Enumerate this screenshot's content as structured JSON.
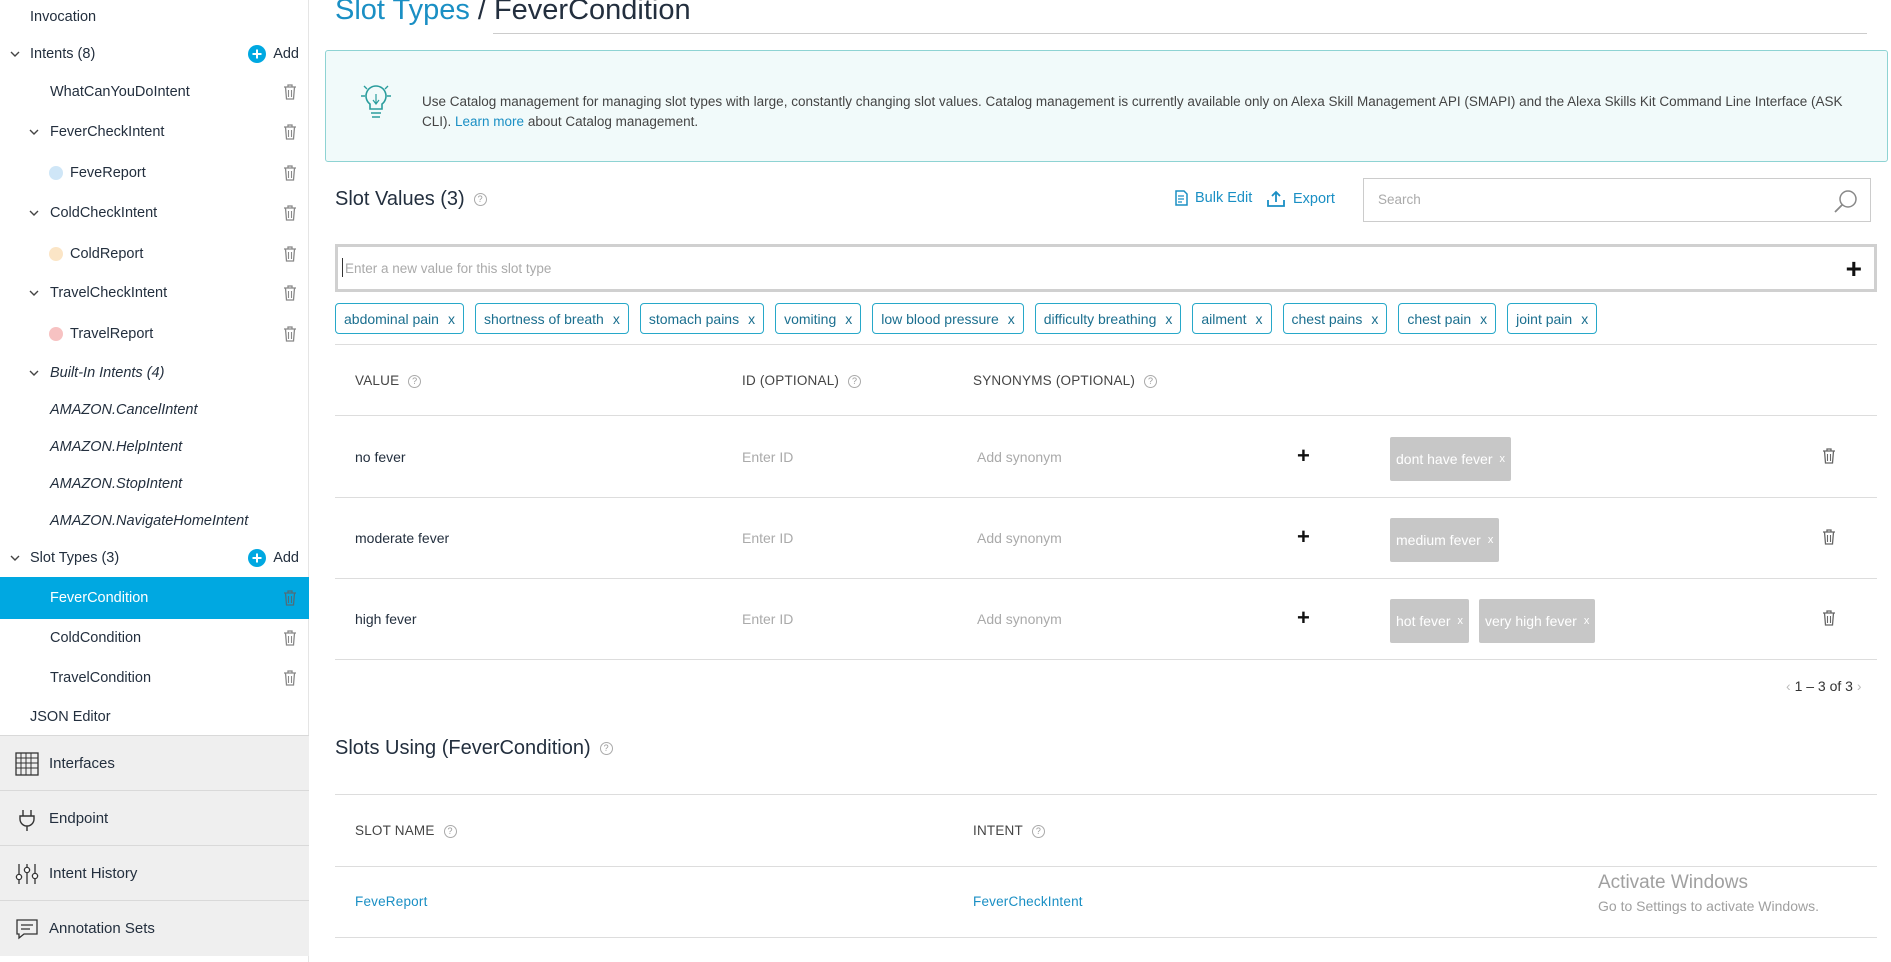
{
  "sidebar": {
    "invocation": "Invocation",
    "intents_header": "Intents (8)",
    "add_label": "Add",
    "intents": [
      {
        "label": "WhatCanYouDoIntent"
      },
      {
        "label": "FeverCheckIntent",
        "slot": "FeveReport",
        "slot_color": "#cfe6f7"
      },
      {
        "label": "ColdCheckIntent",
        "slot": "ColdReport",
        "slot_color": "#fbe5c6"
      },
      {
        "label": "TravelCheckIntent",
        "slot": "TravelReport",
        "slot_color": "#f7c2c2"
      }
    ],
    "builtin_header": "Built-In Intents (4)",
    "builtin": [
      "AMAZON.CancelIntent",
      "AMAZON.HelpIntent",
      "AMAZON.StopIntent",
      "AMAZON.NavigateHomeIntent"
    ],
    "slot_types_header": "Slot Types (3)",
    "slot_types": [
      "FeverCondition",
      "ColdCondition",
      "TravelCondition"
    ],
    "active_slot_type": "FeverCondition",
    "json_editor": "JSON Editor",
    "sections": [
      {
        "label": "Interfaces",
        "icon": "grid-icon"
      },
      {
        "label": "Endpoint",
        "icon": "plug-icon"
      },
      {
        "label": "Intent History",
        "icon": "sliders-icon"
      },
      {
        "label": "Annotation Sets",
        "icon": "annotation-icon"
      }
    ]
  },
  "header": {
    "breadcrumb": "Slot Types",
    "separator": "/",
    "title": "FeverCondition"
  },
  "info": {
    "text_before": "Use Catalog management for managing slot types with large, constantly changing slot values. Catalog management is currently available only on Alexa Skill Management API (SMAPI) and the Alexa Skills Kit Command Line Interface (ASK CLI). ",
    "link": "Learn more",
    "text_after": " about Catalog management."
  },
  "slot_values": {
    "heading": "Slot Values (3)",
    "bulk_edit": "Bulk Edit",
    "export": "Export",
    "search_placeholder": "Search",
    "new_value_placeholder": "Enter a new value for this slot type",
    "chips": [
      "abdominal pain",
      "shortness of breath",
      "stomach pains",
      "vomiting",
      "low blood pressure",
      "difficulty breathing",
      "ailment",
      "chest pains",
      "chest pain",
      "joint pain"
    ],
    "chip_remove": "x",
    "columns": {
      "value": "VALUE",
      "id": "ID (OPTIONAL)",
      "synonyms": "SYNONYMS (OPTIONAL)"
    },
    "id_placeholder": "Enter ID",
    "synonym_placeholder": "Add synonym",
    "rows": [
      {
        "value": "no fever",
        "synonyms": [
          "dont have fever"
        ]
      },
      {
        "value": "moderate fever",
        "synonyms": [
          "medium fever"
        ]
      },
      {
        "value": "high fever",
        "synonyms": [
          "hot fever",
          "very high fever"
        ]
      }
    ],
    "pagination": "1 – 3 of 3"
  },
  "slots_using": {
    "heading": "Slots Using (FeverCondition)",
    "columns": {
      "slot_name": "SLOT NAME",
      "intent": "INTENT"
    },
    "rows": [
      {
        "slot_name": "FeveReport",
        "intent": "FeverCheckIntent"
      }
    ]
  },
  "watermark": {
    "line1": "Activate Windows",
    "line2": "Go to Settings to activate Windows."
  },
  "colors": {
    "accent": "#00a8e1",
    "link": "#1a8fc4",
    "info_bg": "#f1fafa"
  }
}
